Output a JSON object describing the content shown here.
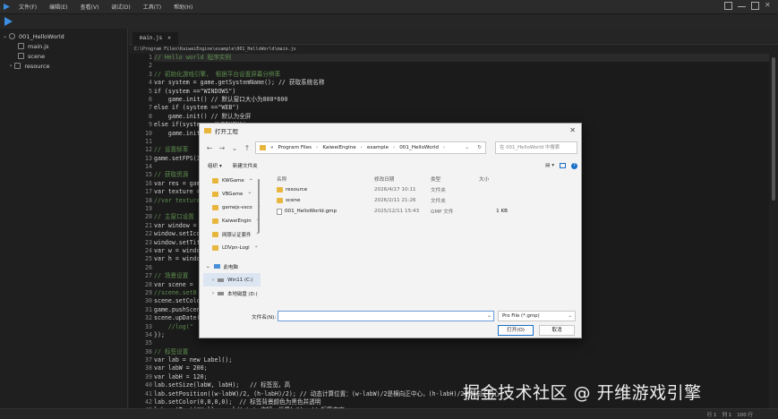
{
  "menu": {
    "items": [
      "文件(F)",
      "编辑(E)",
      "查看(V)",
      "调试(D)",
      "工具(T)",
      "帮助(H)"
    ]
  },
  "sidebar": {
    "project": "001_HelloWorld",
    "items": [
      "main.js",
      "scene",
      "resource"
    ]
  },
  "editor": {
    "tab_label": "main.js",
    "tab_close": "×",
    "path": "C:\\Program Files\\KaiweiEngine\\example\\001_HelloWorld\\main.js",
    "lines": [
      "// Hello world 程序实例",
      "",
      "// 初始化游戏引擎， 根据平台设置屏幕分辨率",
      "var system = game.getSystemName(); // 获取系统名称",
      "if (system ==\"WINDOWS\")",
      "    game.init() // 默认窗口大小为800*600",
      "else if (system ==\"WEB\")",
      "    game.init() // 默认为全屏",
      "else if(system ==\"WEIXIN\")",
      "    game.init(",
      "",
      "// 设置帧率",
      "game.setFPS(3",
      "",
      "// 获取资源",
      "var res = gam",
      "var texture =",
      "//var texture",
      "",
      "// 主窗口设置",
      "var window =",
      "window.setIco",
      "window.setTit",
      "var w = windo",
      "var h = windo",
      "",
      "// 场景设置",
      "var scene =",
      "//scene.setB",
      "scene.setColo",
      "game.pushScen",
      "scene.upDate(",
      "    //log(\"",
      "});",
      "",
      "// 标签设置",
      "var lab = new Label();",
      "var labW = 200;",
      "var labH = 120;",
      "lab.setSize(labW, labH);   // 标签宽，高",
      "lab.setPosition((w-labW)/2, (h-labH)/2); // 动态计算位置：(w-labW)/2是横向正中心，(h-labH)/2是纵向正中心",
      "lab.setColor(0,0,0,0);  // 标签背景颜色为黑色并透明",
      "lab.setText(\"Hello world! \\n\\n你好，世界！\"); // 标签文字"
    ]
  },
  "status": {
    "row": "行 1",
    "col": "列 1",
    "encoding": "100 行"
  },
  "watermark": "掘金技术社区 @ 开维游戏引擎",
  "dialog": {
    "title": "打开工程",
    "close": "✕",
    "nav": {
      "back": "←",
      "forward": "→",
      "down": "⌄",
      "up": "↑"
    },
    "address": [
      "Program Files",
      "KaiweiEngine",
      "example",
      "001_HelloWorld"
    ],
    "address_prefix": "«",
    "address_sep": "›",
    "search_placeholder": "在 001_HelloWorld 中搜索",
    "organize": "组织 ▾",
    "new_folder": "新建文件夹",
    "nav_items": [
      {
        "label": "KWGame",
        "pin": "📌"
      },
      {
        "label": "VBGame",
        "pin": "📌"
      },
      {
        "label": "gamejs-vsco",
        "pin": "📌"
      },
      {
        "label": "KaiweiEngin",
        "pin": "📌"
      },
      {
        "label": "网银认证套件",
        "pin": "📌"
      },
      {
        "label": "LDVpn-Logi",
        "pin": "📌"
      }
    ],
    "this_pc": "此电脑",
    "drives": [
      "Win11 (C:)",
      "本地磁盘 (D:)"
    ],
    "columns": [
      "名称",
      "修改日期",
      "类型",
      "大小"
    ],
    "files": [
      {
        "name": "resource",
        "date": "2026/4/17 10:11",
        "type": "文件夹",
        "size": "",
        "kind": "folder"
      },
      {
        "name": "scene",
        "date": "2026/2/11 21:26",
        "type": "文件夹",
        "size": "",
        "kind": "folder"
      },
      {
        "name": "001_HelloWorld.gmp",
        "date": "2025/12/11 15:43",
        "type": "GMP 文件",
        "size": "1 KB",
        "kind": "file"
      }
    ],
    "filename_label": "文件名(N):",
    "filename_value": "",
    "filter": "Pro File (*.gmp)",
    "open_button": "打开(O)",
    "cancel_button": "取消"
  }
}
